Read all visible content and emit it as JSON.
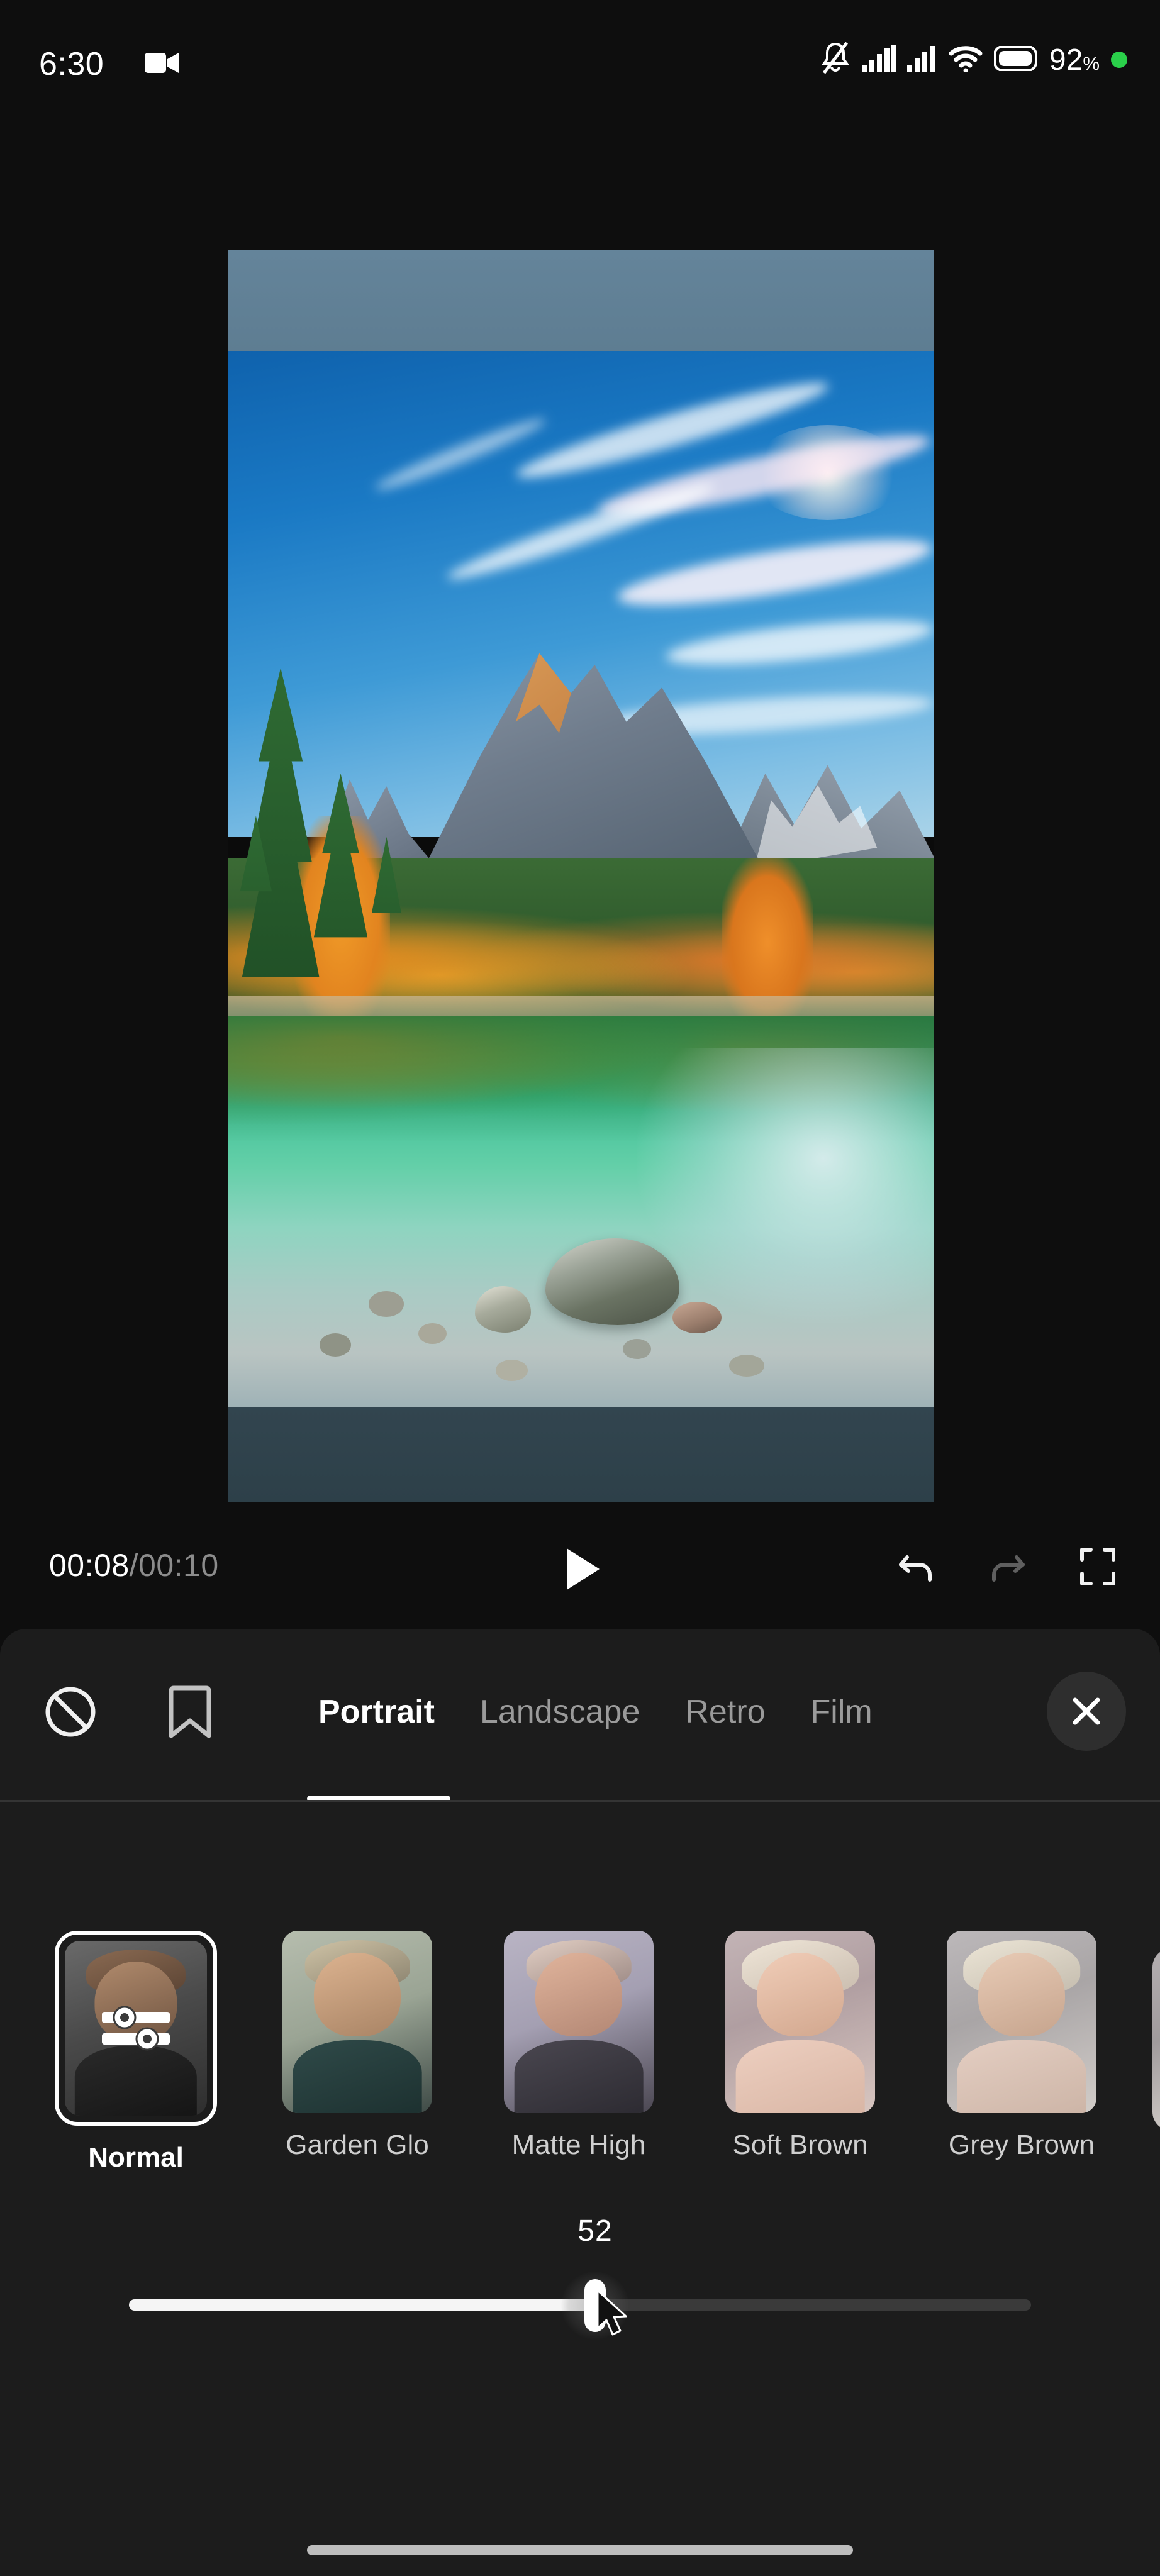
{
  "status_bar": {
    "time": "6:30",
    "battery_percent": "92",
    "battery_unit": "%",
    "icons": [
      "video-camera-icon",
      "bell-muted-icon",
      "signal-bars-icon",
      "signal-bars-secondary-icon",
      "wifi-icon",
      "battery-icon",
      "recording-indicator-dot"
    ],
    "recording_dot_color": "#2ad04a"
  },
  "preview": {
    "name": "video-preview",
    "letterbox_top_color": "#5e7d92",
    "letterbox_bottom_color": "#2d4049",
    "scene_description": "mountain lake landscape with blue sky, conifer and autumn trees, reflections and pebbles"
  },
  "player": {
    "current_time": "00:08",
    "separator": "/",
    "total_time": "00:10",
    "play_label": "play-icon",
    "undo_label": "undo-icon",
    "redo_label": "redo-icon",
    "fullscreen_label": "fullscreen-icon",
    "undo_enabled": true,
    "redo_enabled": false
  },
  "panel": {
    "background": "#1c1c1c",
    "left_icons": [
      {
        "name": "no-filter-icon",
        "label": "None"
      },
      {
        "name": "bookmark-icon",
        "label": "Saved"
      }
    ],
    "tabs": [
      {
        "label": "Portrait",
        "active": true
      },
      {
        "label": "Landscape",
        "active": false
      },
      {
        "label": "Retro",
        "active": false
      },
      {
        "label": "Film",
        "active": false
      }
    ],
    "close_label": "close-icon",
    "accent_color": "#ffffff"
  },
  "filters": {
    "selected_index": 0,
    "items": [
      {
        "label": "Normal",
        "selected": true,
        "overlay_icon": "adjust-sliders-icon",
        "swatch": "#4a4a4a"
      },
      {
        "label": "Garden Glo",
        "selected": false,
        "swatch": "#9aa494"
      },
      {
        "label": "Matte High",
        "selected": false,
        "swatch": "#a49fb2"
      },
      {
        "label": "Soft Brown",
        "selected": false,
        "swatch": "#b09ea1"
      },
      {
        "label": "Grey Brown",
        "selected": false,
        "swatch": "#a9a5a6"
      }
    ]
  },
  "slider": {
    "name": "filter-intensity-slider",
    "value": "52",
    "min": 0,
    "max": 100,
    "fill_color": "#f5f5f5",
    "track_color": "#3a3a3a"
  },
  "system": {
    "home_indicator": "home-indicator"
  }
}
